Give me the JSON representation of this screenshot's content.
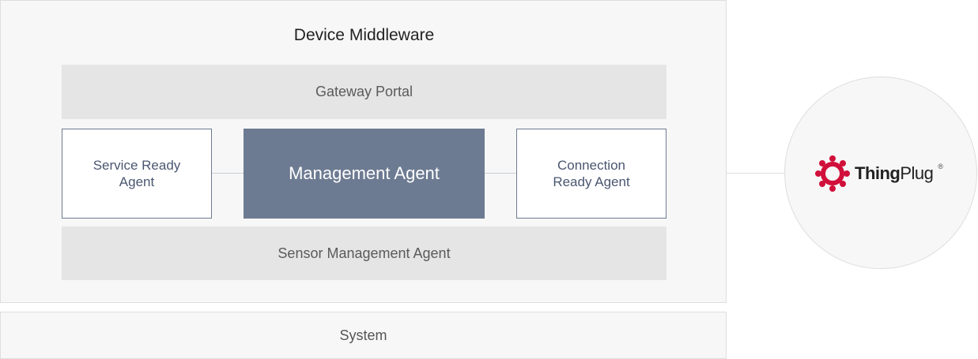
{
  "middleware": {
    "title": "Device Middleware",
    "gateway_portal": "Gateway Portal",
    "service_ready_agent": [
      "Service Ready",
      "Agent"
    ],
    "management_agent": "Management Agent",
    "connection_ready_agent": [
      "Connection",
      "Ready Agent"
    ],
    "sensor_management_agent": "Sensor Management Agent"
  },
  "system": {
    "label": "System"
  },
  "platform": {
    "logo_name": "thingplug-logo-icon",
    "brand_thing": "Thing",
    "brand_plug": "Plug",
    "brand_mark": "®",
    "logo_color": "#d0103a"
  },
  "colors": {
    "management_fill": "#6d7b92",
    "panel_bg": "#f7f7f7",
    "bar_bg": "#e5e5e5"
  }
}
